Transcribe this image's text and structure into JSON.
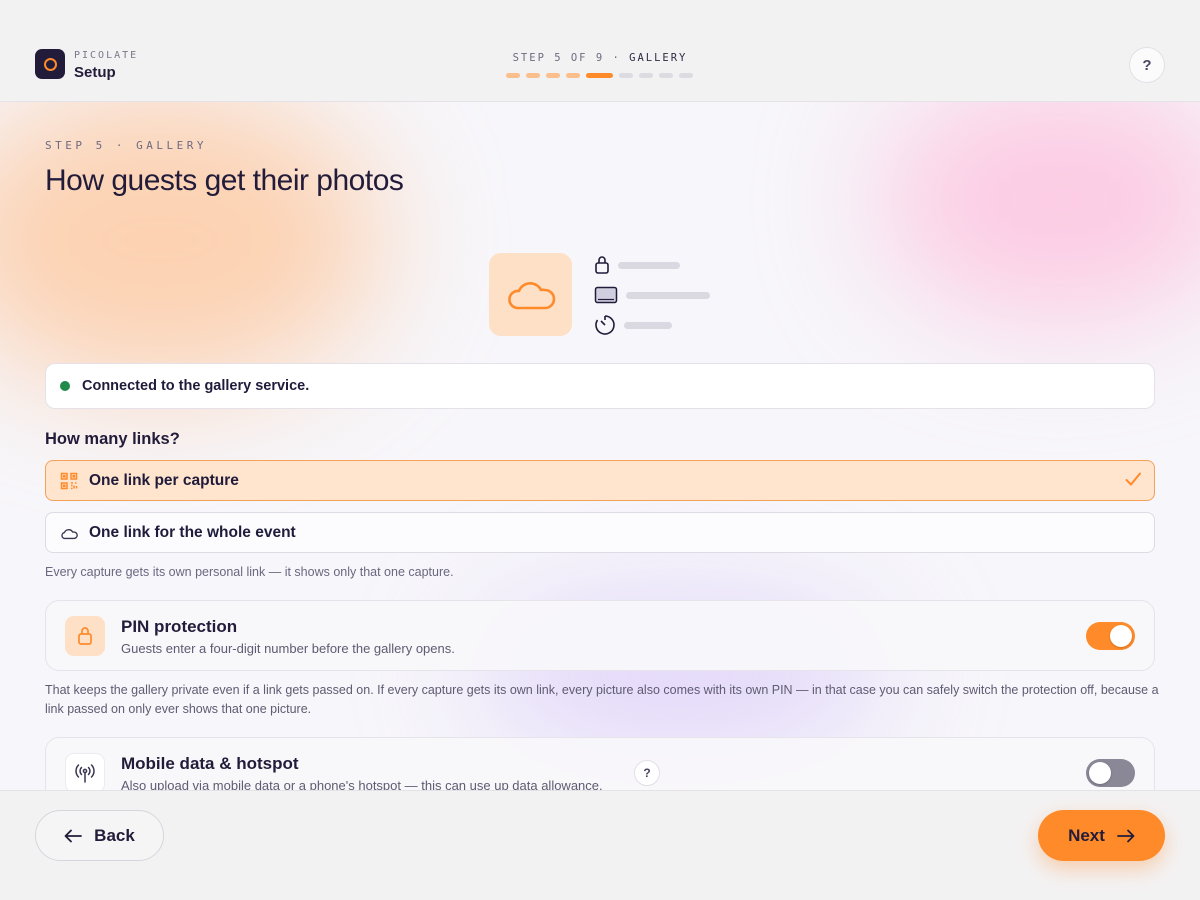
{
  "colors": {
    "accent": "#ff8a2a",
    "status_ok": "#1f8a4c",
    "text": "#221c3a"
  },
  "header": {
    "brand_small": "PICOLATE",
    "brand_title": "Setup",
    "step_prefix": "STEP 5 OF 9 · ",
    "step_section": "GALLERY",
    "progress": {
      "current": 5,
      "total": 9
    },
    "help_label": "?"
  },
  "page": {
    "eyebrow": "STEP 5 · GALLERY",
    "title": "How guests get their photos"
  },
  "illustration": {
    "main_icon": "cloud-icon",
    "rows": [
      "lock-icon",
      "screen-icon",
      "timer-icon"
    ]
  },
  "status": {
    "text": "Connected to the gallery service."
  },
  "links": {
    "title": "How many links?",
    "options": [
      {
        "label": "One link per capture",
        "icon": "qr-code-icon",
        "selected": true
      },
      {
        "label": "One link for the whole event",
        "icon": "cloud-icon",
        "selected": false
      }
    ],
    "hint": "Every capture gets its own personal link — it shows only that one capture."
  },
  "pin": {
    "title": "PIN protection",
    "subtitle": "Guests enter a four-digit number before the gallery opens.",
    "enabled": true,
    "explanation": "That keeps the gallery private even if a link gets passed on. If every capture gets its own link, every picture also comes with its own PIN — in that case you can safely switch the protection off, because a link passed on only ever shows that one picture."
  },
  "mobile": {
    "title": "Mobile data & hotspot",
    "subtitle": "Also upload via mobile data or a phone's hotspot — this can use up data allowance.",
    "help_label": "?",
    "enabled": false
  },
  "footer": {
    "back_label": "Back",
    "next_label": "Next"
  }
}
